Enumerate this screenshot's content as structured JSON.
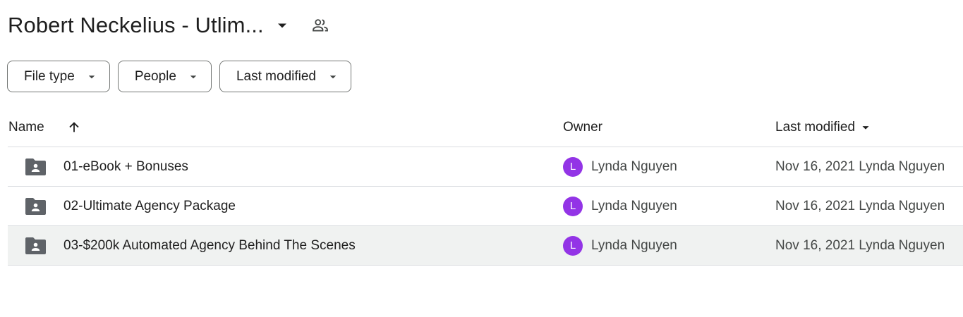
{
  "header": {
    "title": "Robert Neckelius - Utlim...",
    "caret_icon": "arrow-drop-down-icon",
    "shared_icon": "people-icon"
  },
  "filters": [
    {
      "label": "File type"
    },
    {
      "label": "People"
    },
    {
      "label": "Last modified"
    }
  ],
  "columns": {
    "name": "Name",
    "owner": "Owner",
    "last_modified": "Last modified"
  },
  "rows": [
    {
      "name": "01-eBook + Bonuses",
      "owner_initial": "L",
      "owner": "Lynda Nguyen",
      "modified": "Nov 16, 2021 Lynda Nguyen"
    },
    {
      "name": "02-Ultimate Agency Package",
      "owner_initial": "L",
      "owner": "Lynda Nguyen",
      "modified": "Nov 16, 2021 Lynda Nguyen"
    },
    {
      "name": "03-$200k Automated Agency Behind The Scenes",
      "owner_initial": "L",
      "owner": "Lynda Nguyen",
      "modified": "Nov 16, 2021 Lynda Nguyen"
    }
  ],
  "colors": {
    "avatar": "#9334e6",
    "icon": "#5f6368",
    "row_hover": "#f0f2f1"
  }
}
